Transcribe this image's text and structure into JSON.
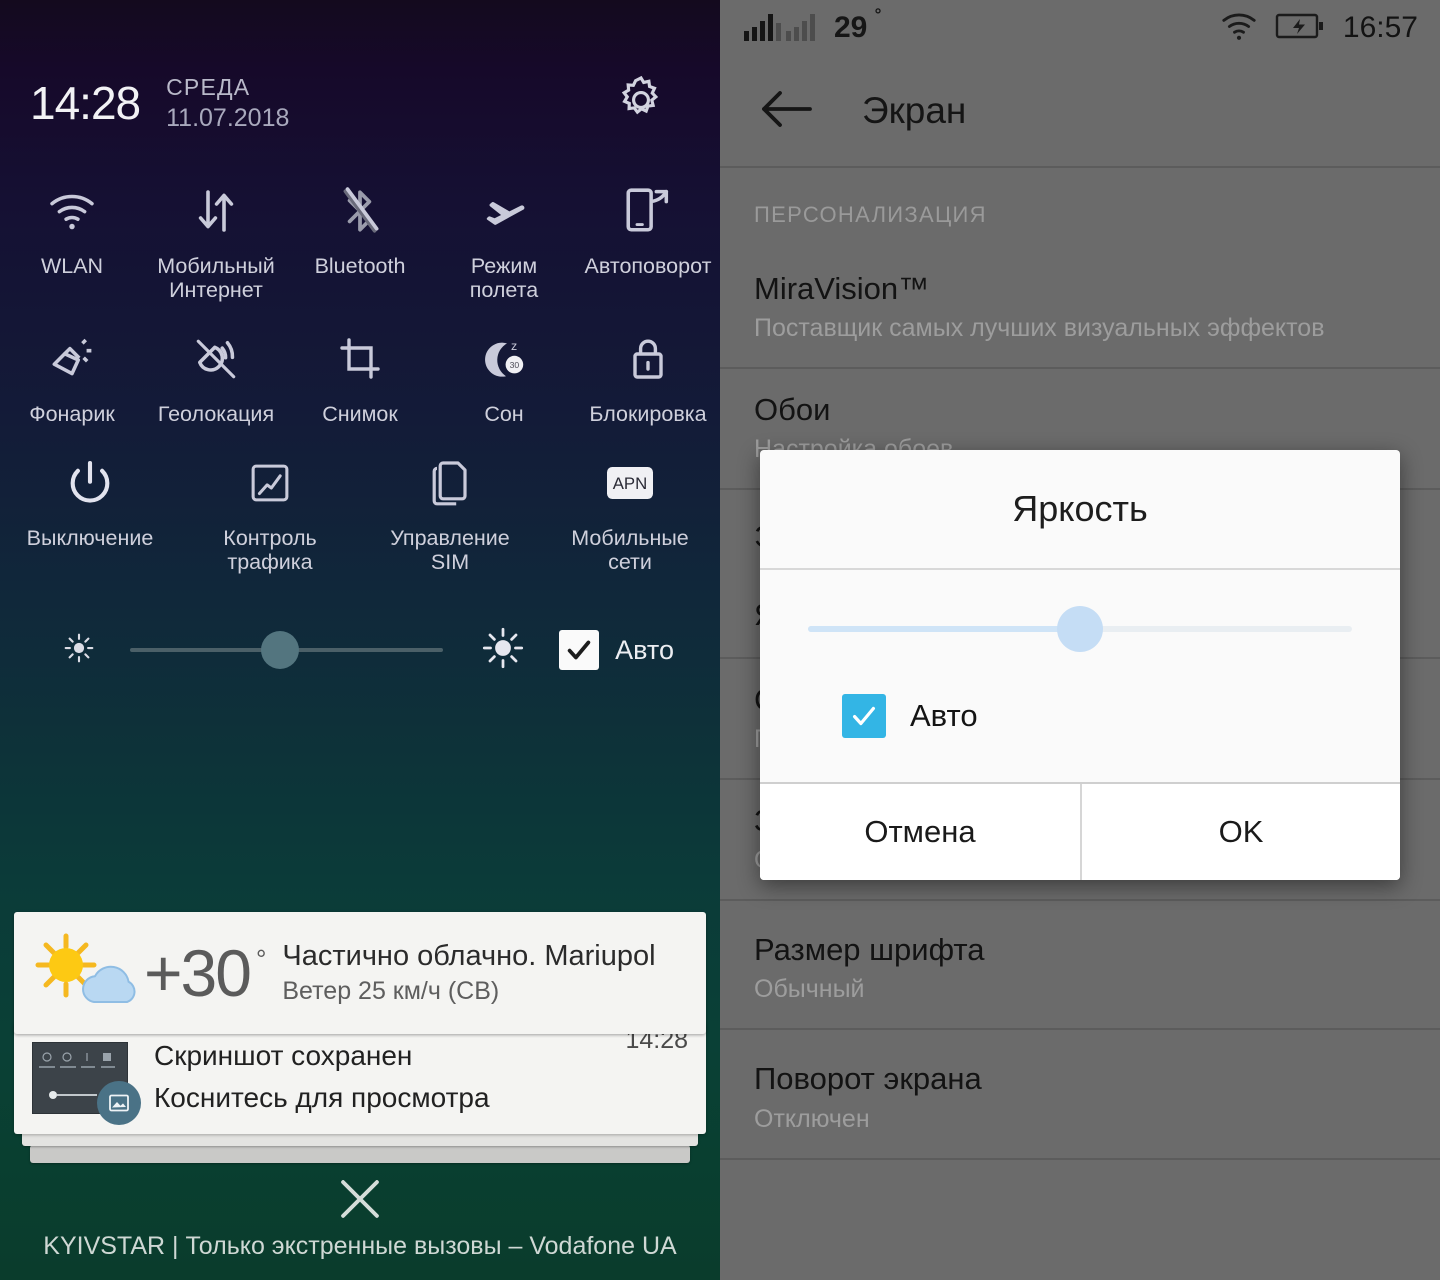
{
  "shade": {
    "clock": "14:28",
    "day_of_week": "СРЕДА",
    "date": "11.07.2018",
    "settings_icon": "gear-icon",
    "tiles": [
      [
        {
          "label": "WLAN",
          "icon": "wifi-icon"
        },
        {
          "label": "Мобильный\nИнтернет",
          "icon": "mobile-data-icon"
        },
        {
          "label": "Bluetooth",
          "icon": "bluetooth-off-icon"
        },
        {
          "label": "Режим\nполета",
          "icon": "airplane-icon"
        },
        {
          "label": "Автоповорот",
          "icon": "auto-rotate-icon"
        }
      ],
      [
        {
          "label": "Фонарик",
          "icon": "flashlight-icon"
        },
        {
          "label": "Геолокация",
          "icon": "location-off-icon"
        },
        {
          "label": "Снимок",
          "icon": "screenshot-icon"
        },
        {
          "label": "Сон",
          "icon": "sleep-moon-icon"
        },
        {
          "label": "Блокировка",
          "icon": "lock-icon"
        }
      ],
      [
        {
          "label": "Выключение",
          "icon": "power-icon"
        },
        {
          "label": "Контроль\nтрафика",
          "icon": "traffic-chart-icon"
        },
        {
          "label": "Управление\nSIM",
          "icon": "sim-cards-icon"
        },
        {
          "label": "Мобильные\nсети",
          "icon": "apn-icon"
        }
      ]
    ],
    "brightness": {
      "low_icon": "brightness-low-icon",
      "high_icon": "brightness-high-icon",
      "value_percent": 48,
      "auto_label": "Авто",
      "auto_checked": true
    },
    "weather": {
      "icon": "sun-cloud-icon",
      "temperature": "+30",
      "degree": "°",
      "title": "Частично облачно. Mariupol",
      "subtitle": "Ветер 25 км/ч (СВ)"
    },
    "screenshot_notification": {
      "thumbnail_icon": "screenshot-thumbnail",
      "badge_icon": "gallery-image-icon",
      "title": "Скриншот сохранен",
      "subtitle": "Коснитесь для просмотра",
      "time": "14:28"
    },
    "close_icon": "close-x-icon",
    "carrier": "KYIVSTAR | Только экстренные вызовы – Vodafone UA"
  },
  "settings": {
    "statusbar": {
      "signal_icon": "dual-signal-bars-icon",
      "temperature": "29",
      "degree": "°",
      "wifi_icon": "wifi-icon",
      "battery_icon": "battery-charging-icon",
      "time": "16:57"
    },
    "appbar": {
      "back_icon": "back-arrow-icon",
      "title": "Экран"
    },
    "section_header": "ПЕРСОНАЛИЗАЦИЯ",
    "rows": [
      {
        "title": "MiraVision™",
        "subtitle": "Поставщик самых лучших визуальных эффектов"
      },
      {
        "title": "Обои",
        "subtitle": "Настройка обоев"
      },
      {
        "title": "Э",
        "subtitle": ""
      },
      {
        "title": "Я",
        "subtitle": ""
      },
      {
        "title": "С",
        "subtitle": "П"
      },
      {
        "title": "З",
        "subtitle": "О"
      },
      {
        "title": "Размер шрифта",
        "subtitle": "Обычный"
      },
      {
        "title": "Поворот экрана",
        "subtitle": "Отключен"
      }
    ]
  },
  "dialog": {
    "title": "Яркость",
    "slider_percent": 50,
    "auto_label": "Авто",
    "auto_checked": true,
    "cancel_label": "Отмена",
    "ok_label": "OK"
  },
  "colors": {
    "accent_blue": "#33b5e5",
    "slider_blue": "#c5ddf5",
    "settings_bg": "#6b6b6b",
    "card_bg": "#f4f4f2"
  }
}
